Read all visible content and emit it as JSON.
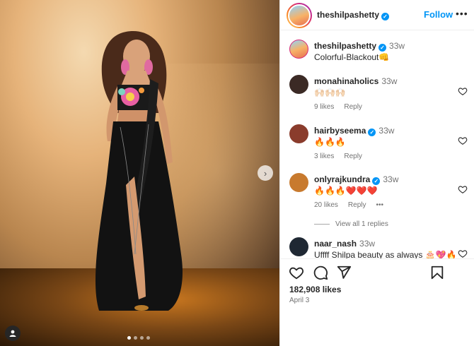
{
  "post": {
    "username": "theshilpashetty",
    "follow_label": "Follow",
    "more_label": "•••",
    "caption_username": "theshilpashetty",
    "caption_time": "33w",
    "caption_text": "Colorful-Blackout👊",
    "likes": "182,908 likes",
    "date": "April 3",
    "media_count": 4,
    "media_active": 1,
    "next_label": "›"
  },
  "comments": [
    {
      "username": "monahinaholics",
      "time": "33w",
      "text": "🙌🏻🙌🏻🙌🏻",
      "likes": "9 likes",
      "reply": "Reply",
      "avatar_color": "#3b2a25"
    },
    {
      "username": "hairbyseema",
      "time": "33w",
      "text": "🔥🔥🔥",
      "likes": "3 likes",
      "reply": "Reply",
      "avatar_color": "#8a3c2c"
    },
    {
      "username": "onlyrajkundra",
      "time": "33w",
      "text": "🔥🔥🔥❤️❤️❤️",
      "likes": "20 likes",
      "reply": "Reply",
      "more": "•••",
      "avatar_color": "#c87a2e",
      "view_replies": "View all 1 replies"
    },
    {
      "username": "naar_nash",
      "time": "33w",
      "text": "Uffff Shilpa beauty as always 🎂💖🔥",
      "avatar_color": "#1f2833"
    }
  ],
  "colors": {
    "accent": "#0095f6",
    "text": "#262626",
    "muted": "#737373",
    "divider": "#efefef"
  },
  "icons": [
    "heart-icon",
    "comment-icon",
    "share-icon",
    "bookmark-icon",
    "verified-badge-icon",
    "user-tag-icon",
    "chevron-right-icon"
  ]
}
